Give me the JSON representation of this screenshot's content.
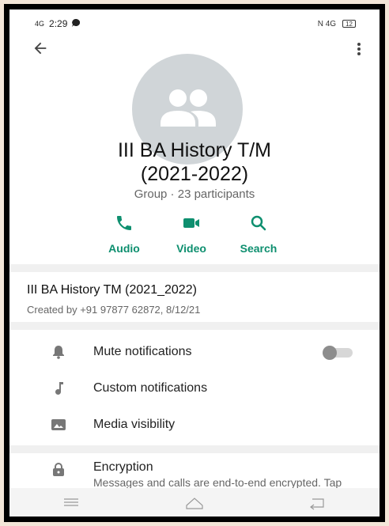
{
  "status_bar": {
    "network": "4G",
    "time": "2:29",
    "right_indicators": "N  4G",
    "battery": "12"
  },
  "group": {
    "title_line1": "III BA History T/M",
    "title_line2": "(2021-2022)",
    "subtitle": "Group · 23 participants"
  },
  "actions": [
    {
      "label": "Audio",
      "icon": "phone-icon"
    },
    {
      "label": "Video",
      "icon": "video-camera-icon"
    },
    {
      "label": "Search",
      "icon": "search-icon"
    }
  ],
  "description": {
    "title": "III BA History TM (2021_2022)",
    "created": "Created by +91 97877 62872, 8/12/21"
  },
  "settings": {
    "mute": "Mute notifications",
    "mute_enabled": false,
    "custom": "Custom notifications",
    "media": "Media visibility"
  },
  "encryption": {
    "label": "Encryption",
    "desc": "Messages and calls are end-to-end encrypted. Tap to learn more."
  },
  "colors": {
    "accent": "#0e8f6f",
    "avatar_bg": "#d0d5d8"
  }
}
